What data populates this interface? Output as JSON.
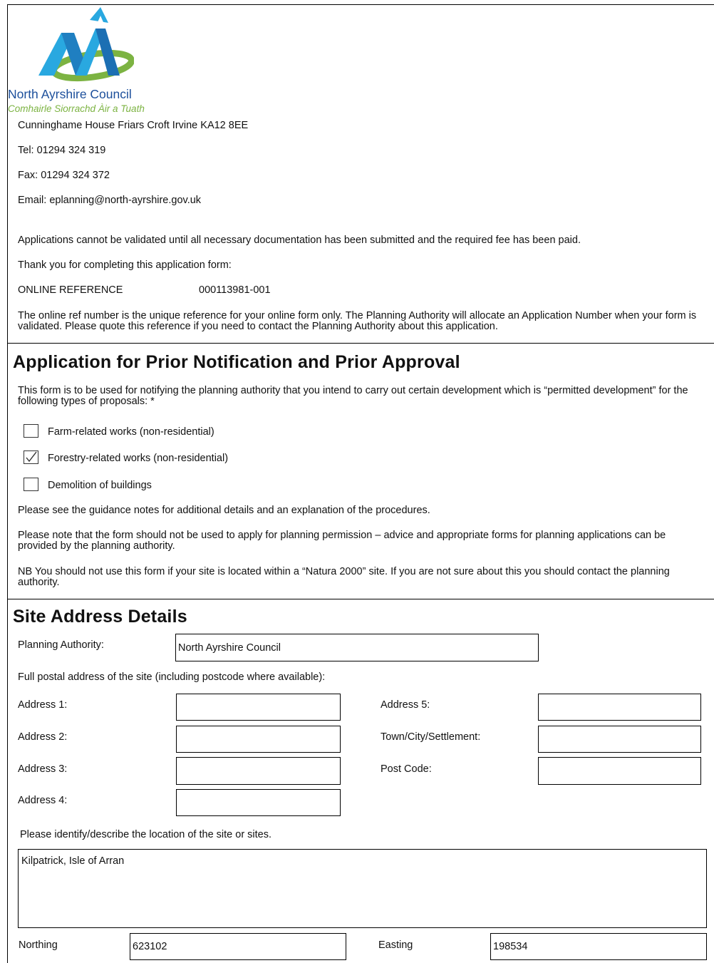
{
  "council": {
    "name": "North Ayrshire Council",
    "gaelic_name": "Comhairle Siorrachd Àir a Tuath",
    "address": "Cunninghame House Friars Croft Irvine KA12 8EE",
    "tel": "Tel: 01294 324 319",
    "fax": "Fax: 01294 324 372",
    "email": "Email: eplanning@north-ayrshire.gov.uk",
    "brand_blue": "#1c4f9b",
    "brand_green": "#7cb342",
    "brand_cyan": "#29a8e0"
  },
  "intro": {
    "validation_note": "Applications cannot be validated until all necessary documentation has been submitted and the required fee has been paid.",
    "thanks": "Thank you for completing this application form:",
    "ref_label": "ONLINE REFERENCE",
    "ref_value": "000113981-001",
    "ref_note": "The online ref number is the unique reference for your online form only. The Planning Authority will allocate an Application Number when your form is validated. Please quote this reference if you need to contact the Planning Authority about this application."
  },
  "prior_notification": {
    "title": "Application for Prior Notification and Prior Approval",
    "description": "This form is to be used for notifying the planning authority that you intend to carry out certain development which is “permitted development” for the following types of proposals: *",
    "options": [
      {
        "label": "Farm-related works (non-residential)",
        "checked": false
      },
      {
        "label": "Forestry-related works (non-residential)",
        "checked": true
      },
      {
        "label": "Demolition of buildings",
        "checked": false
      }
    ],
    "guidance": "Please see the guidance notes for additional details and an explanation of the procedures.",
    "permission_note": "Please note that the form should not be used to apply for planning permission – advice and appropriate forms for planning applications can be provided by the planning authority.",
    "natura_note": "NB  You should not use this form if your site is located within a “Natura 2000” site. If you are not sure about this you should contact the planning authority."
  },
  "site_address": {
    "title": "Site Address Details",
    "planning_authority_label": "Planning Authority:",
    "planning_authority_value": "North Ayrshire Council",
    "postal_prompt": "Full postal address of the site (including postcode where available):",
    "address1_label": "Address 1:",
    "address1_value": "",
    "address2_label": "Address 2:",
    "address2_value": "",
    "address3_label": "Address 3:",
    "address3_value": "",
    "address4_label": "Address 4:",
    "address4_value": "",
    "address5_label": "Address 5:",
    "address5_value": "",
    "town_label": "Town/City/Settlement:",
    "town_value": "",
    "postcode_label": "Post Code:",
    "postcode_value": "",
    "location_prompt": "Please identify/describe the location of the site or sites.",
    "location_value": "Kilpatrick, Isle of Arran",
    "northing_label": "Northing",
    "northing_value": "623102",
    "easting_label": "Easting",
    "easting_value": "198534"
  }
}
